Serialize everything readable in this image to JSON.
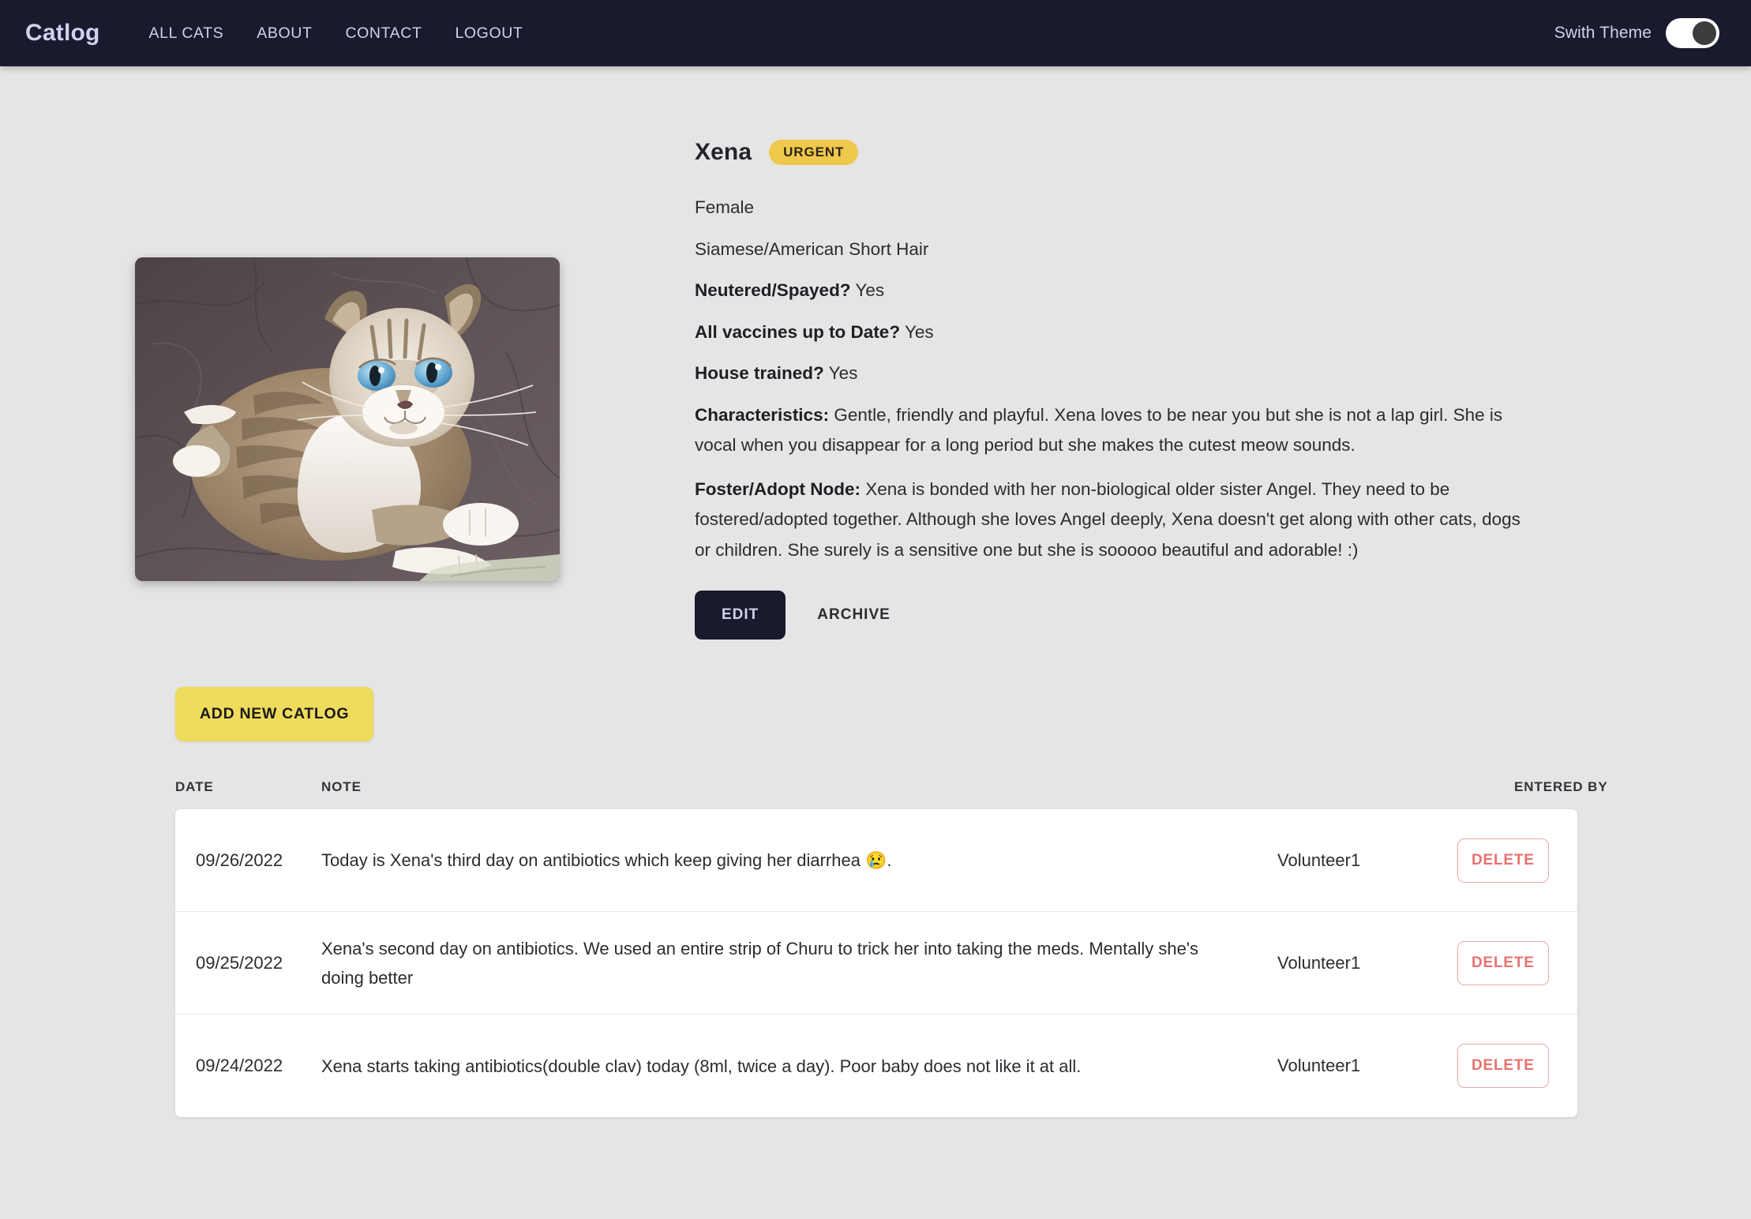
{
  "navbar": {
    "brand": "Catlog",
    "links": [
      {
        "label": "ALL CATS"
      },
      {
        "label": "ABOUT"
      },
      {
        "label": "CONTACT"
      },
      {
        "label": "LOGOUT"
      }
    ],
    "theme_label": "Swith Theme",
    "theme_toggle_state": "on"
  },
  "cat": {
    "name": "Xena",
    "badge": "URGENT",
    "sex": "Female",
    "breed": "Siamese/American Short Hair",
    "neutered_label": "Neutered/Spayed?",
    "neutered_value": "Yes",
    "vaccines_label": "All vaccines up to Date?",
    "vaccines_value": "Yes",
    "house_trained_label": "House trained?",
    "house_trained_value": "Yes",
    "characteristics_label": "Characteristics:",
    "characteristics_value": "Gentle, friendly and playful. Xena loves to be near you but she is not a lap girl. She is vocal when you disappear for a long period but she makes the cutest meow sounds.",
    "foster_label": "Foster/Adopt Node:",
    "foster_value": "Xena is bonded with her non-biological older sister Angel. They need to be fostered/adopted together. Although she loves Angel deeply, Xena doesn't get along with other cats, dogs or children. She surely is a sensitive one but she is sooooo beautiful and adorable! :)",
    "edit_label": "EDIT",
    "archive_label": "ARCHIVE"
  },
  "catlog": {
    "add_label": "ADD NEW CATLOG",
    "columns": {
      "date": "DATE",
      "note": "NOTE",
      "entered_by": "ENTERED BY"
    },
    "delete_label": "DELETE",
    "rows": [
      {
        "date": "09/26/2022",
        "note": "Today is Xena's third day on antibiotics which keep giving her diarrhea 😢.",
        "entered_by": "Volunteer1",
        "delete_label": "DELETE"
      },
      {
        "date": "09/25/2022",
        "note": "Xena's second day on antibiotics. We used an entire strip of Churu to trick her into taking the meds. Mentally she's doing better",
        "entered_by": "Volunteer1",
        "delete_label": "DELETE"
      },
      {
        "date": "09/24/2022",
        "note": "Xena starts taking antibiotics(double clav) today (8ml, twice a day). Poor baby does not like it at all.",
        "entered_by": "Volunteer1",
        "delete_label": "DELETE"
      }
    ]
  },
  "colors": {
    "navbar_bg": "#191a2e",
    "nav_text": "#d3cfef",
    "page_bg": "#e5e5e5",
    "badge_bg": "#efc84c",
    "add_button_bg": "#efdb5c",
    "delete_text": "#e8716f",
    "card_bg": "#ffffff"
  }
}
